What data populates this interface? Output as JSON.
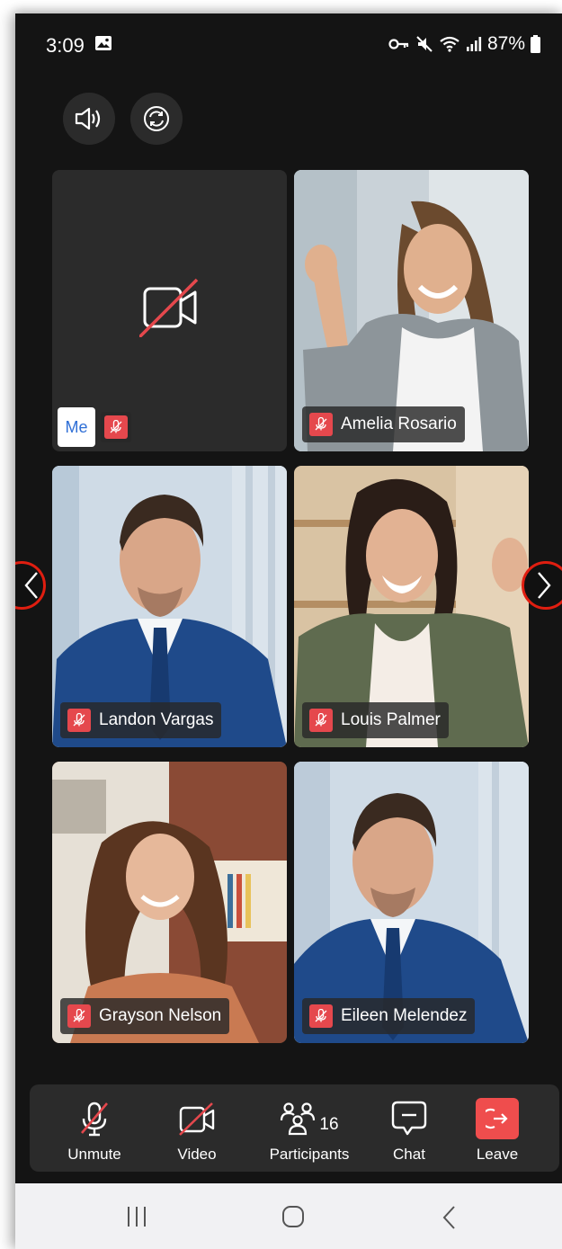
{
  "status_bar": {
    "time": "3:09",
    "battery": "87%"
  },
  "top_controls": {
    "speaker_icon": "speaker-icon",
    "switch_camera_icon": "switch-camera-icon"
  },
  "tiles": [
    {
      "name": "Me",
      "video_off": true,
      "muted": true
    },
    {
      "name": "Amelia Rosario",
      "muted": true
    },
    {
      "name": "Landon Vargas",
      "muted": true
    },
    {
      "name": "Louis Palmer",
      "muted": true
    },
    {
      "name": "Grayson Nelson",
      "muted": true
    },
    {
      "name": "Eileen Melendez",
      "muted": true
    }
  ],
  "toolbar": {
    "unmute_label": "Unmute",
    "video_label": "Video",
    "participants_label": "Participants",
    "participants_count": "16",
    "chat_label": "Chat",
    "leave_label": "Leave"
  },
  "colors": {
    "accent_red": "#ef4d4d",
    "background": "#141414",
    "highlight_ring": "#e01e10"
  }
}
